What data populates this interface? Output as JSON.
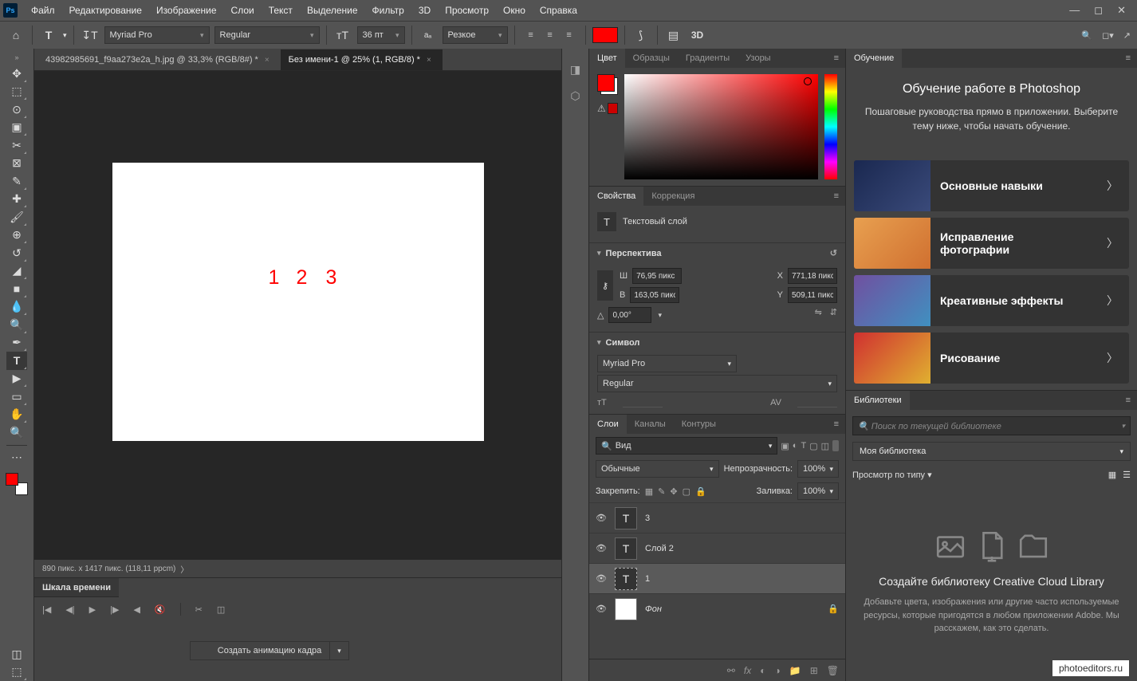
{
  "menu": [
    "Файл",
    "Редактирование",
    "Изображение",
    "Слои",
    "Текст",
    "Выделение",
    "Фильтр",
    "3D",
    "Просмотр",
    "Окно",
    "Справка"
  ],
  "options": {
    "font": "Myriad Pro",
    "weight": "Regular",
    "size": "36 пт",
    "aa": "Резкое",
    "color": "#ff0000"
  },
  "tabs": [
    {
      "label": "43982985691_f9aa273e2a_h.jpg @ 33,3% (RGB/8#) *",
      "active": false
    },
    {
      "label": "Без имени-1 @ 25% (1, RGB/8) *",
      "active": true
    }
  ],
  "canvas_text": [
    "1",
    "2",
    "3"
  ],
  "status": "890 пикс. x 1417 пикс. (118,11 ppcm)",
  "timeline": {
    "tab": "Шкала времени",
    "create": "Создать анимацию кадра"
  },
  "color_tabs": [
    "Цвет",
    "Образцы",
    "Градиенты",
    "Узоры"
  ],
  "props": {
    "tab1": "Свойства",
    "tab2": "Коррекция",
    "layer_type": "Текстовый слой",
    "persp": "Перспектива",
    "w": "76,95 пикс",
    "h": "163,05 пикс",
    "x": "771,18 пикс",
    "y": "509,11 пикс",
    "angle": "0,00°",
    "symbol": "Символ",
    "font": "Myriad Pro",
    "weight": "Regular"
  },
  "layers": {
    "tabs": [
      "Слои",
      "Каналы",
      "Контуры"
    ],
    "search": "Вид",
    "blend": "Обычные",
    "opacity_l": "Непрозрачность:",
    "opacity": "100%",
    "lock": "Закрепить:",
    "fill_l": "Заливка:",
    "fill": "100%",
    "items": [
      {
        "name": "3",
        "type": "T"
      },
      {
        "name": "Слой 2",
        "type": "T"
      },
      {
        "name": "1",
        "type": "T",
        "sel": true
      },
      {
        "name": "Фон",
        "type": "bg"
      }
    ]
  },
  "learn": {
    "tab": "Обучение",
    "title": "Обучение работе в Photoshop",
    "sub": "Пошаговые руководства прямо в приложении. Выберите тему ниже, чтобы начать обучение.",
    "cards": [
      {
        "label": "Основные навыки",
        "bg": "linear-gradient(135deg,#1a2850,#3a4a7a)"
      },
      {
        "label": "Исправление фотографии",
        "bg": "linear-gradient(135deg,#e8a050,#d07030)"
      },
      {
        "label": "Креативные эффекты",
        "bg": "linear-gradient(135deg,#7050a0,#4090c0)"
      },
      {
        "label": "Рисование",
        "bg": "linear-gradient(135deg,#d03030,#e0b030)"
      }
    ]
  },
  "lib": {
    "tab": "Библиотеки",
    "search_ph": "Поиск по текущей библиотеке",
    "mylib": "Моя библиотека",
    "view": "Просмотр по типу",
    "t1": "Создайте библиотеку Creative Cloud Library",
    "t2": "Добавьте цвета, изображения или другие часто используемые ресурсы, которые пригодятся в любом приложении Adobe. Мы расскажем, как это сделать."
  },
  "watermark": "photoeditors.ru"
}
